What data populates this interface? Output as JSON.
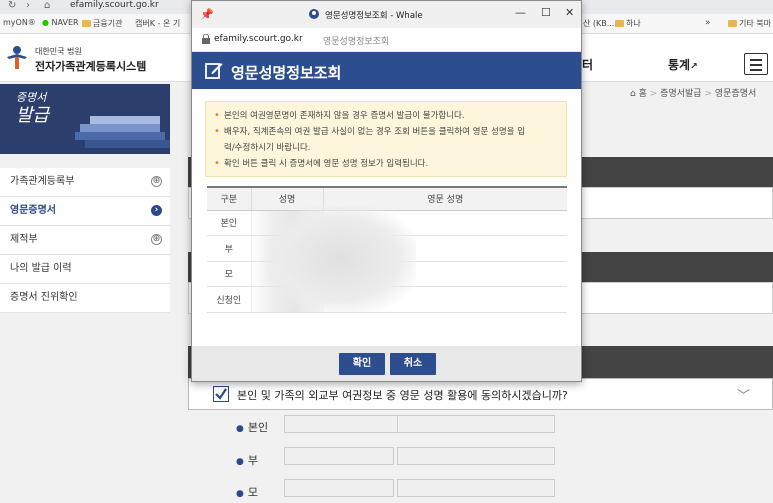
{
  "browser": {
    "url_text": "efamily.scourt.go.kr",
    "bookmarks": [
      {
        "label": "myON®"
      },
      {
        "label": "NAVER"
      },
      {
        "label": "금융기관"
      },
      {
        "label": "캡버K - 온 기"
      },
      {
        "label": "산 (KB..."
      },
      {
        "label": "하나"
      },
      {
        "label": "기타 북마"
      }
    ],
    "more": "»"
  },
  "site": {
    "logo_small": "대한민국 법원",
    "logo_main": "전자가족관계등록시스템",
    "nav_partial": "터",
    "nav_stats": "통계"
  },
  "sidebar": {
    "banner_title_1": "증명서",
    "banner_title_2": "발급",
    "items": [
      {
        "label": "가족관계등록부",
        "icon": "⊕"
      },
      {
        "label": "영문증명서",
        "icon": "›"
      },
      {
        "label": "제적부",
        "icon": "⊕"
      },
      {
        "label": "나의 발급 이력",
        "icon": ""
      },
      {
        "label": "증명서 진위확인",
        "icon": ""
      }
    ]
  },
  "breadcrumb": {
    "home": "홈",
    "sep": ">",
    "level1": "증명서발급",
    "level2": "영문증명서"
  },
  "main": {
    "agree_text": "본인 및 가족의 외교부 여권정보 중 영문 성명 활용에 동의하시겠습니까?",
    "fields": [
      {
        "label": "본인"
      },
      {
        "label": "부"
      },
      {
        "label": "모"
      }
    ]
  },
  "popup": {
    "window_title": "영문성명정보조회 - Whale",
    "address_domain": "efamily.scourt.go.kr",
    "address_title": "영문성명정보조회",
    "heading": "영문성명정보조회",
    "notice": [
      "본인의 여권영문명이 존재하지 않을 경우 증명서 발급이 불가합니다.",
      "배우자, 직계존속의 여권 발급 사실이 없는 경우 조회 버튼을 클릭하여 영문 성명을 입",
      "력/수정하시기 바랍니다.",
      "확인 버튼 클릭 시 증명서에 영문 성명 정보가 입력됩니다."
    ],
    "table": {
      "headers": [
        "구분",
        "성명",
        "영문 성명"
      ],
      "rows": [
        {
          "kind": "본인"
        },
        {
          "kind": "부"
        },
        {
          "kind": "모"
        },
        {
          "kind": "신청인"
        }
      ]
    },
    "confirm_label": "확인",
    "cancel_label": "취소"
  },
  "colors": {
    "brand_blue": "#2c4d8e",
    "notice_bg": "#fdf6dc",
    "bullet_orange": "#e08a1e"
  }
}
